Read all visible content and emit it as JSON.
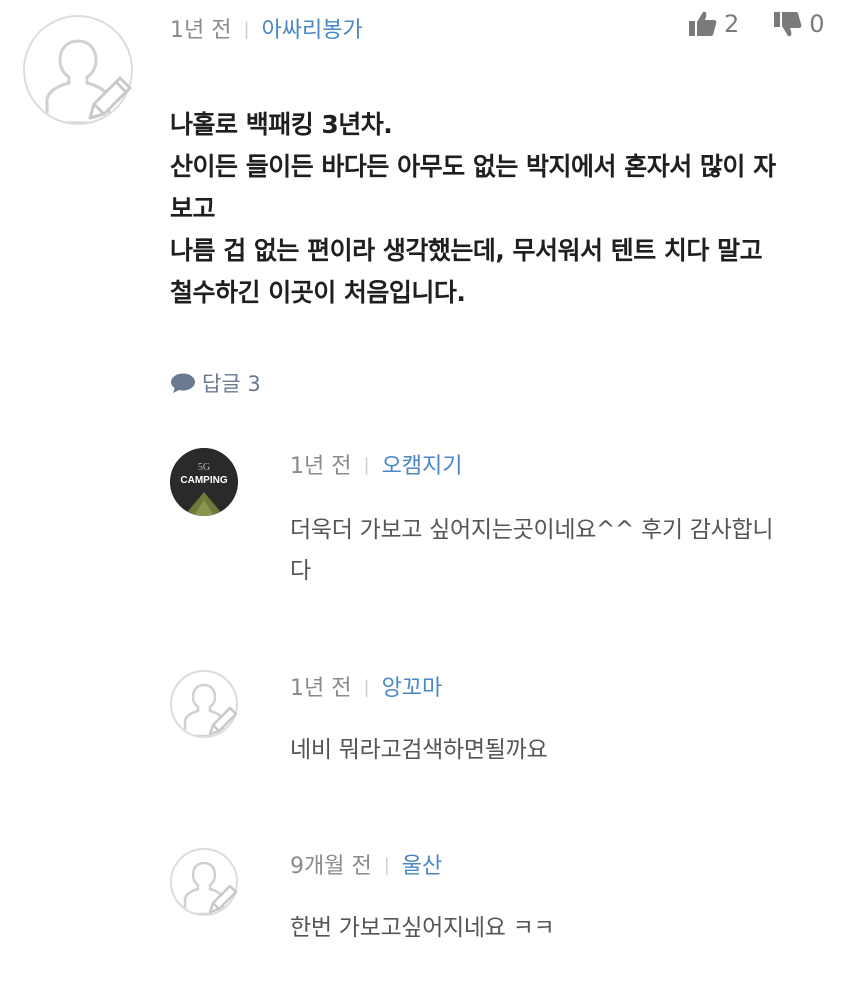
{
  "comment": {
    "time": "1년 전",
    "author": "아싸리봉가",
    "likes": "2",
    "dislikes": "0",
    "lines": [
      "나홀로 백패킹 3년차.",
      "산이든 들이든 바다든 아무도 없는 박지에서 혼자서 많이 자",
      "보고",
      "나름 겁 없는 편이라 생각했는데, 무서워서 텐트 치다 말고",
      "철수하긴 이곳이 처음입니다."
    ],
    "replies_label": "답글 3"
  },
  "replies": [
    {
      "time": "1년 전",
      "author": "오캠지기",
      "avatar_text": "CAMPING",
      "avatar_badge": "5G",
      "lines": [
        "더욱더 가보고 싶어지는곳이네요^^ 후기 감사합니",
        "다"
      ]
    },
    {
      "time": "1년 전",
      "author": "앙꼬마",
      "lines": [
        "네비 뭐라고검색하면될까요"
      ]
    },
    {
      "time": "9개월 전",
      "author": "울산",
      "lines": [
        "한번 가보고싶어지네요 ㅋㅋ"
      ]
    }
  ],
  "colors": {
    "author": "#4a86c6",
    "meta": "#8a8a8a",
    "body": "#1f1f1f",
    "reply_body": "#555555"
  }
}
